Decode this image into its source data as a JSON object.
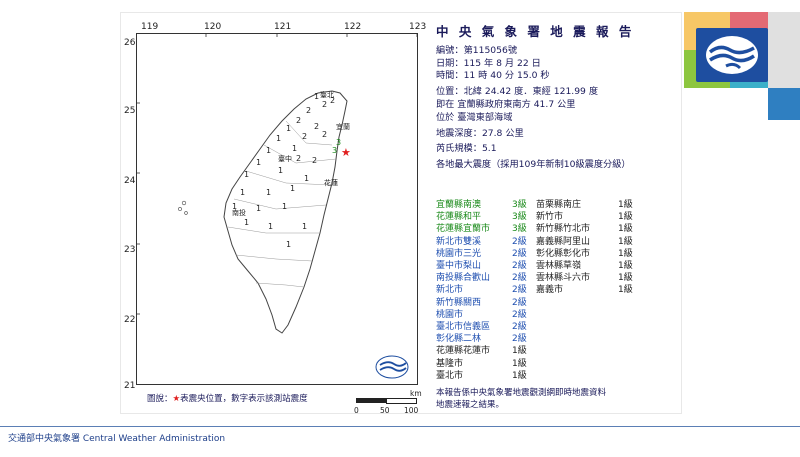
{
  "report": {
    "title": "中 央 氣 象 署 地 震 報 告",
    "number_label": "編號：",
    "number_value": "第115056號",
    "date_label": "日期：",
    "date_value": "115 年 8 月 22 日",
    "time_label": "時間：",
    "time_value": "11 時 40 分 15.0 秒",
    "position_label": "位置：",
    "position_value": "北緯 24.42 度．東經 121.99 度",
    "location_line": "即在 宜蘭縣政府東南方 41.7 公里",
    "region_line": "位於 臺灣東部海域",
    "depth_label": "地震深度：",
    "depth_value": "27.8 公里",
    "magnitude_label": "芮氏規模：",
    "magnitude_value": "5.1",
    "intensity_heading": "各地最大震度（採用109年新制10級震度分級）"
  },
  "intensity_left": [
    {
      "place": "宜蘭縣南澳",
      "level": "3級",
      "color": "#1a8a1a"
    },
    {
      "place": "花蓮縣和平",
      "level": "3級",
      "color": "#1a8a1a"
    },
    {
      "place": "花蓮縣宜蘭市",
      "level": "3級",
      "color": "#1a8a1a"
    },
    {
      "place": "新北市雙溪",
      "level": "2級",
      "color": "#1f4fb0"
    },
    {
      "place": "桃園市三光",
      "level": "2級",
      "color": "#1f4fb0"
    },
    {
      "place": "臺中市梨山",
      "level": "2級",
      "color": "#1f4fb0"
    },
    {
      "place": "南投縣合歡山",
      "level": "2級",
      "color": "#1f4fb0"
    },
    {
      "place": "新北市",
      "level": "2級",
      "color": "#1f4fb0"
    },
    {
      "place": "新竹縣關西",
      "level": "2級",
      "color": "#1f4fb0"
    },
    {
      "place": "桃園市",
      "level": "2級",
      "color": "#1f4fb0"
    },
    {
      "place": "臺北市信義區",
      "level": "2級",
      "color": "#1f4fb0"
    },
    {
      "place": "彰化縣二林",
      "level": "2級",
      "color": "#1f4fb0"
    },
    {
      "place": "花蓮縣花蓮市",
      "level": "1級",
      "color": "#222222"
    },
    {
      "place": "基隆市",
      "level": "1級",
      "color": "#222222"
    },
    {
      "place": "臺北市",
      "level": "1級",
      "color": "#222222"
    }
  ],
  "intensity_right": [
    {
      "place": "苗栗縣南庄",
      "level": "1級"
    },
    {
      "place": "新竹市",
      "level": "1級"
    },
    {
      "place": "新竹縣竹北市",
      "level": "1級"
    },
    {
      "place": "嘉義縣阿里山",
      "level": "1級"
    },
    {
      "place": "彰化縣彰化市",
      "level": "1級"
    },
    {
      "place": "雲林縣草嶺",
      "level": "1級"
    },
    {
      "place": "雲林縣斗六市",
      "level": "1級"
    },
    {
      "place": "嘉義市",
      "level": "1級"
    }
  ],
  "note": {
    "line1": "本報告係中央氣象署地震觀測網即時地震資料",
    "line2": "地震速報之結果。"
  },
  "map": {
    "lon_ticks": [
      "119",
      "120",
      "121",
      "122",
      "123"
    ],
    "lat_ticks": [
      "26",
      "25",
      "24",
      "23",
      "22",
      "21"
    ],
    "scale_labels": [
      "0",
      "50",
      "100"
    ],
    "scale_unit": "km",
    "city_yilan": "宜蘭",
    "city_hualien": "花蓮",
    "city_taichung": "臺中",
    "city_nantou": "南投",
    "city_taipei": "臺北",
    "station_intensities": [
      "1",
      "1",
      "1",
      "2",
      "2",
      "2",
      "2",
      "2",
      "1",
      "1",
      "1",
      "1",
      "1",
      "1",
      "1",
      "1",
      "2",
      "3",
      "3",
      "1",
      "1",
      "1",
      "2",
      "2",
      "1",
      "1",
      "1",
      "1",
      "1",
      "1",
      "1",
      "1",
      "1"
    ]
  },
  "legend": {
    "prefix": "圖說：",
    "star": "★",
    "text": "表震央位置，數字表示該測站震度"
  },
  "footer": {
    "text": "交通部中央氣象署 Central Weather Administration"
  },
  "colors": {
    "title": "#1a1a5a",
    "level3": "#1a8a1a",
    "level2": "#1f4fb0",
    "star": "#e02020",
    "logo": "#1e4ea0"
  }
}
